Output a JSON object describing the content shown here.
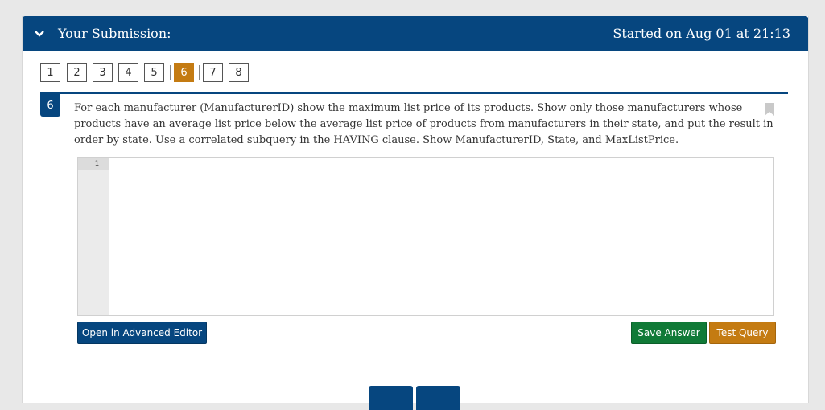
{
  "header": {
    "title": "Your Submission:",
    "started": "Started on Aug 01 at 21:13",
    "chevron_icon": "chevron-down-icon",
    "bg_color": "#06467f"
  },
  "question_nav": {
    "items": [
      "1",
      "2",
      "3",
      "4",
      "5",
      "6",
      "7",
      "8"
    ],
    "current": "6",
    "current_color": "#c47b12"
  },
  "question": {
    "number": "6",
    "text": "For each manufacturer (ManufacturerID) show the maximum list price of its products.  Show only those manufacturers whose products have an average list price below the average list price of products from manufacturers in their state, and put the result in order by state. Use a correlated subquery in the HAVING clause. Show ManufacturerID, State, and MaxListPrice.",
    "bookmark_icon": "bookmark-icon"
  },
  "editor": {
    "line_number": "1",
    "value": ""
  },
  "actions": {
    "advanced_editor": "Open in Advanced Editor",
    "save_answer": "Save Answer",
    "test_query": "Test Query",
    "save_color": "#107a37",
    "test_color": "#c47b12"
  }
}
